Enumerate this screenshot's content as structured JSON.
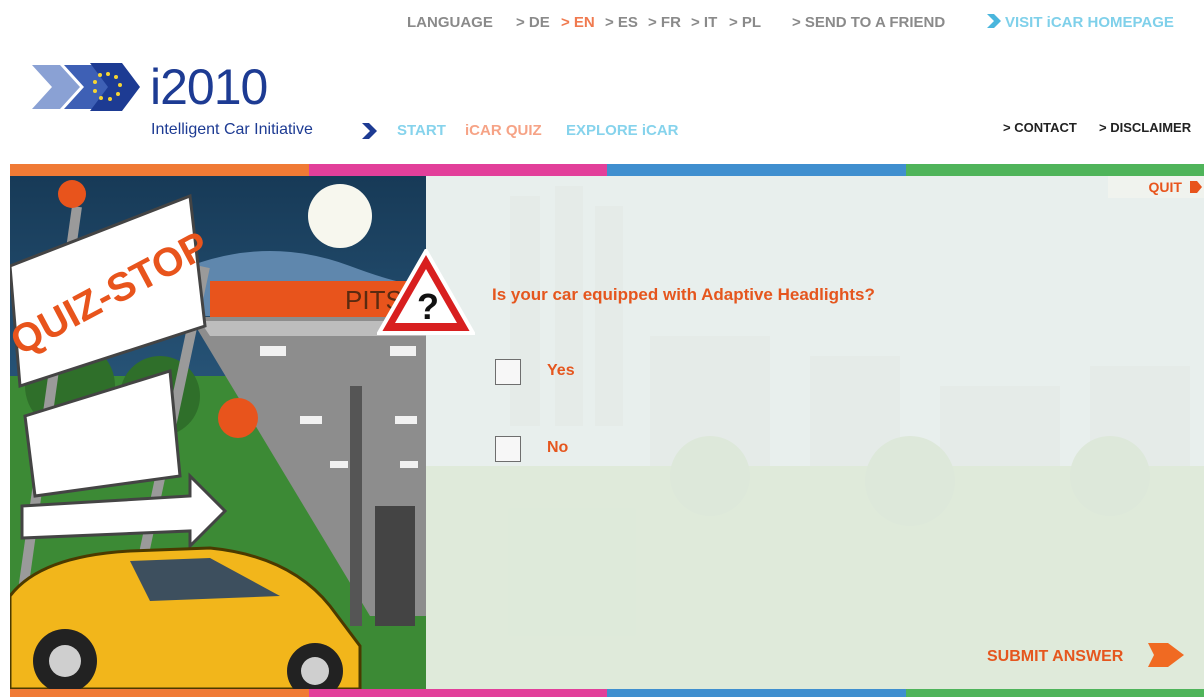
{
  "header": {
    "language_label": "LANGUAGE",
    "languages": [
      "> DE",
      "> EN",
      "> ES",
      "> FR",
      "> IT",
      "> PL"
    ],
    "active_language": "EN",
    "send_to_friend": "> SEND TO A FRIEND",
    "visit_homepage": "VISIT iCAR HOMEPAGE"
  },
  "logo": {
    "title": "i2010",
    "subtitle": "Intelligent Car Initiative"
  },
  "subnav": {
    "items": [
      "START",
      "iCAR QUIZ",
      "EXPLORE iCAR"
    ]
  },
  "utility_nav": {
    "contact": "> CONTACT",
    "disclaimer": "> DISCLAIMER"
  },
  "scene": {
    "sign_text": "QUIZ-STOP",
    "station_text": "PITS"
  },
  "quiz": {
    "quit_label": "QUIT",
    "question_mark": "?",
    "question": "Is your car equipped with Adaptive Headlights?",
    "options": [
      "Yes",
      "No"
    ],
    "submit_label": "SUBMIT ANSWER"
  },
  "colors": {
    "orange": "#f07a35",
    "magenta": "#e23f9a",
    "blue": "#3f8fcf",
    "green": "#4fb45a",
    "accent_text": "#e5561e",
    "brand_blue": "#1d3b93"
  }
}
